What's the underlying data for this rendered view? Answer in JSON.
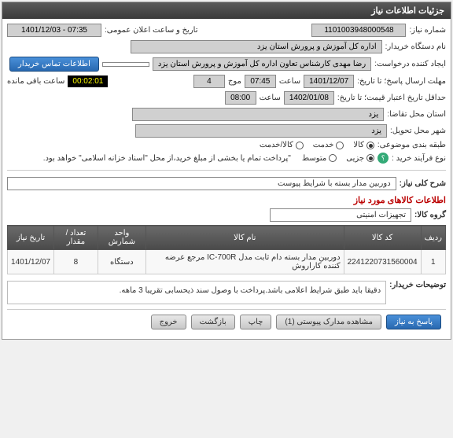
{
  "header": {
    "title": "جزئیات اطلاعات نیاز"
  },
  "fields": {
    "request_no_lbl": "شماره نیاز:",
    "request_no": "1101003948000548",
    "announce_lbl": "تاریخ و ساعت اعلان عمومی:",
    "announce_val": "1401/12/03 - 07:35",
    "buyer_lbl": "نام دستگاه خریدار:",
    "buyer_val": "اداره کل آموزش و پرورش استان یزد",
    "creator_lbl": "ایجاد کننده درخواست:",
    "creator_val": "رضا مهدی کارشناس تعاون اداره کل آموزش و پرورش استان یزد",
    "contact_btn": "اطلاعات تماس خریدار",
    "deadline_lbl": "مهلت ارسال پاسخ؛ تا تاریخ:",
    "deadline_date": "1401/12/07",
    "time_lbl": "ساعت",
    "deadline_time": "07:45",
    "ext_lbl": "موج",
    "ext_val": "4",
    "remain_lbl": "ساعت باقی مانده",
    "remain_val": "00:02:01",
    "valid_lbl": "حداقل تاریخ اعتبار قیمت؛ تا تاریخ:",
    "valid_date": "1402/01/08",
    "valid_time": "08:00",
    "prov_req_lbl": "استان محل تقاضا:",
    "prov_req": "یزد",
    "city_del_lbl": "شهر محل تحویل:",
    "city_del": "یزد",
    "subject_lbl": "طبقه بندی موضوعی:",
    "subject_goods": "کالا",
    "subject_service": "خدمت",
    "subject_both": "کالا/خدمت",
    "proc_lbl": "نوع فرآیند خرید :",
    "proc_small": "جزیی",
    "proc_mid": "متوسط",
    "proc_note": "\"پرداخت تمام یا بخشی از مبلغ خرید،از محل \"اسناد خزانه اسلامی\" خواهد بود.",
    "q": "؟"
  },
  "summary": {
    "title_lbl": "شرح کلی نیاز:",
    "title_val": "دوربین مدار بسته با شرایط پیوست",
    "items_header": "اطلاعات کالاهای مورد نیاز",
    "group_lbl": "گروه کالا:",
    "group_val": "تجهیزات امنیتی"
  },
  "table": {
    "cols": [
      "ردیف",
      "کد کالا",
      "نام کالا",
      "واحد شمارش",
      "تعداد / مقدار",
      "تاریخ نیاز"
    ],
    "rows": [
      {
        "idx": "1",
        "code": "2241220731560004",
        "name": "دوربین مدار بسته دام ثابت مدل IC-700R مرجع عرضه کننده کاراروش",
        "unit": "دستگاه",
        "qty": "8",
        "date": "1401/12/07"
      }
    ]
  },
  "notes": {
    "lbl": "توضیحات خریدار:",
    "val": "دقیقا باید طبق شرایط اعلامی باشد.پرداخت با وصول سند ذیحسابی تقریبا 3 ماهه."
  },
  "toolbar": {
    "reply": "پاسخ به نیاز",
    "attach": "مشاهده مدارک پیوستی (1)",
    "print": "چاپ",
    "back": "بازگشت",
    "exit": "خروج"
  }
}
